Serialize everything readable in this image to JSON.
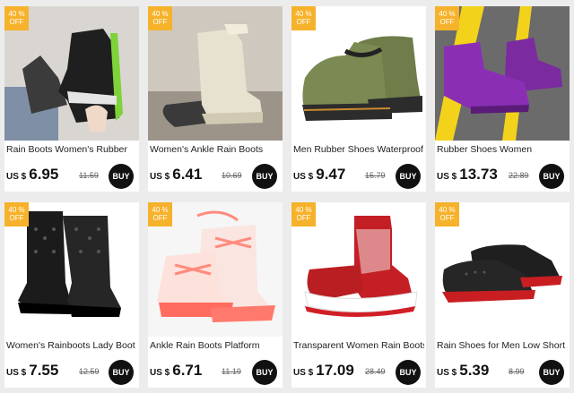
{
  "products": [
    {
      "badge_pct": "40 %",
      "badge_off": "OFF",
      "title": "Rain Boots Women's Rubber",
      "currency": "US $",
      "price": "6.95",
      "old_price": "11.59",
      "buy_label": "BUY"
    },
    {
      "badge_pct": "40 %",
      "badge_off": "OFF",
      "title": "Women's Ankle Rain Boots",
      "currency": "US $",
      "price": "6.41",
      "old_price": "10.69",
      "buy_label": "BUY"
    },
    {
      "badge_pct": "40 %",
      "badge_off": "OFF",
      "title": "Men Rubber Shoes Waterproof",
      "currency": "US $",
      "price": "9.47",
      "old_price": "15.79",
      "buy_label": "BUY"
    },
    {
      "badge_pct": "40 %",
      "badge_off": "OFF",
      "title": "Rubber Shoes Women",
      "currency": "US $",
      "price": "13.73",
      "old_price": "22.89",
      "buy_label": "BUY"
    },
    {
      "badge_pct": "40 %",
      "badge_off": "OFF",
      "title": "Women's Rainboots Lady Boot",
      "currency": "US $",
      "price": "7.55",
      "old_price": "12.59",
      "buy_label": "BUY"
    },
    {
      "badge_pct": "40 %",
      "badge_off": "OFF",
      "title": "Ankle Rain Boots Platform",
      "currency": "US $",
      "price": "6.71",
      "old_price": "11.19",
      "buy_label": "BUY"
    },
    {
      "badge_pct": "40 %",
      "badge_off": "OFF",
      "title": "Transparent Women Rain Boots",
      "currency": "US $",
      "price": "17.09",
      "old_price": "28.49",
      "buy_label": "BUY"
    },
    {
      "badge_pct": "40 %",
      "badge_off": "OFF",
      "title": "Rain Shoes for Men Low Short",
      "currency": "US $",
      "price": "5.39",
      "old_price": "8.99",
      "buy_label": "BUY"
    }
  ],
  "colors": {
    "badge": "#f6b22b",
    "buy": "#111111"
  }
}
